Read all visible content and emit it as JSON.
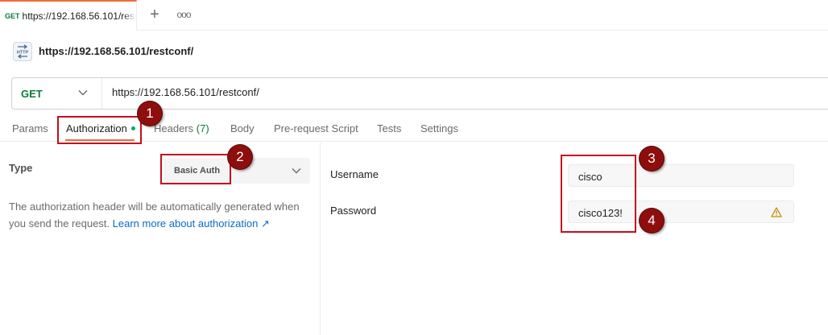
{
  "tab": {
    "method": "GET",
    "title": "https://192.168.56.101/restconf/"
  },
  "tab_actions": {
    "new_tab": "+",
    "more": "ooo"
  },
  "request": {
    "icon_label": "HTTP",
    "title": "https://192.168.56.101/restconf/",
    "method": "GET",
    "url": "https://192.168.56.101/restconf/"
  },
  "subtabs": {
    "params": "Params",
    "authorization": "Authorization",
    "headers": "Headers",
    "headers_count": "(7)",
    "body": "Body",
    "prerequest": "Pre-request Script",
    "tests": "Tests",
    "settings": "Settings"
  },
  "auth": {
    "type_label": "Type",
    "type_value": "Basic Auth",
    "help_text": "The authorization header will be automatically generated when you send the request.",
    "help_link": "Learn more about authorization ↗",
    "username_label": "Username",
    "username_value": "cisco",
    "password_label": "Password",
    "password_value": "cisco123!"
  },
  "annotations": [
    "1",
    "2",
    "3",
    "4"
  ],
  "colors": {
    "accent": "#f26b3a",
    "method_green": "#0d7a3a",
    "link_blue": "#0b6bcb",
    "annotation_red": "#c40d1e",
    "badge_red": "#8e0e0e",
    "warning": "#c98a00"
  },
  "icons": {
    "http": "http-icon",
    "chevron": "chevron-down-icon",
    "warning": "warning-icon",
    "status_dot": "status-dot-icon"
  }
}
